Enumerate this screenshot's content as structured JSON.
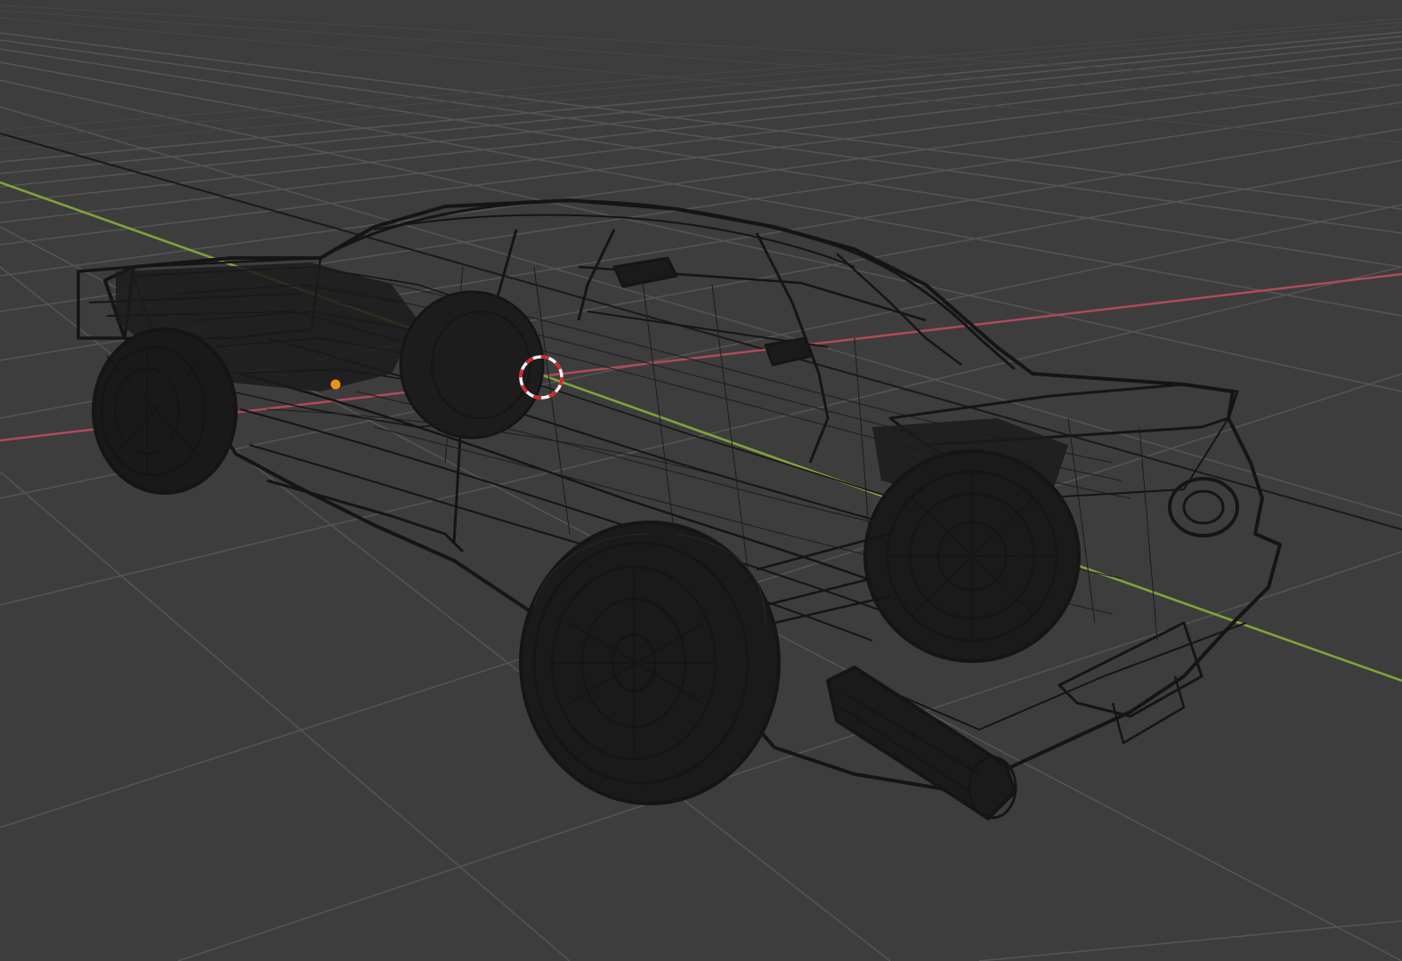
{
  "viewport": {
    "mode": "wireframe",
    "background_color": "#3d3d3d"
  },
  "colors": {
    "grid_line": "#545454",
    "grid_line_far": "#4a4a4a",
    "x_axis": "#b24a5a",
    "y_axis": "#7fa43b",
    "wire": "#151515",
    "wire_light": "#1e1e1e",
    "object_origin": "#f0901c",
    "cursor_red": "#d8262a",
    "cursor_white": "#f2f2f2"
  },
  "scene": {
    "object": "car-wireframe-mesh",
    "cursor": "3d-cursor",
    "origin": "object-origin-dot"
  }
}
